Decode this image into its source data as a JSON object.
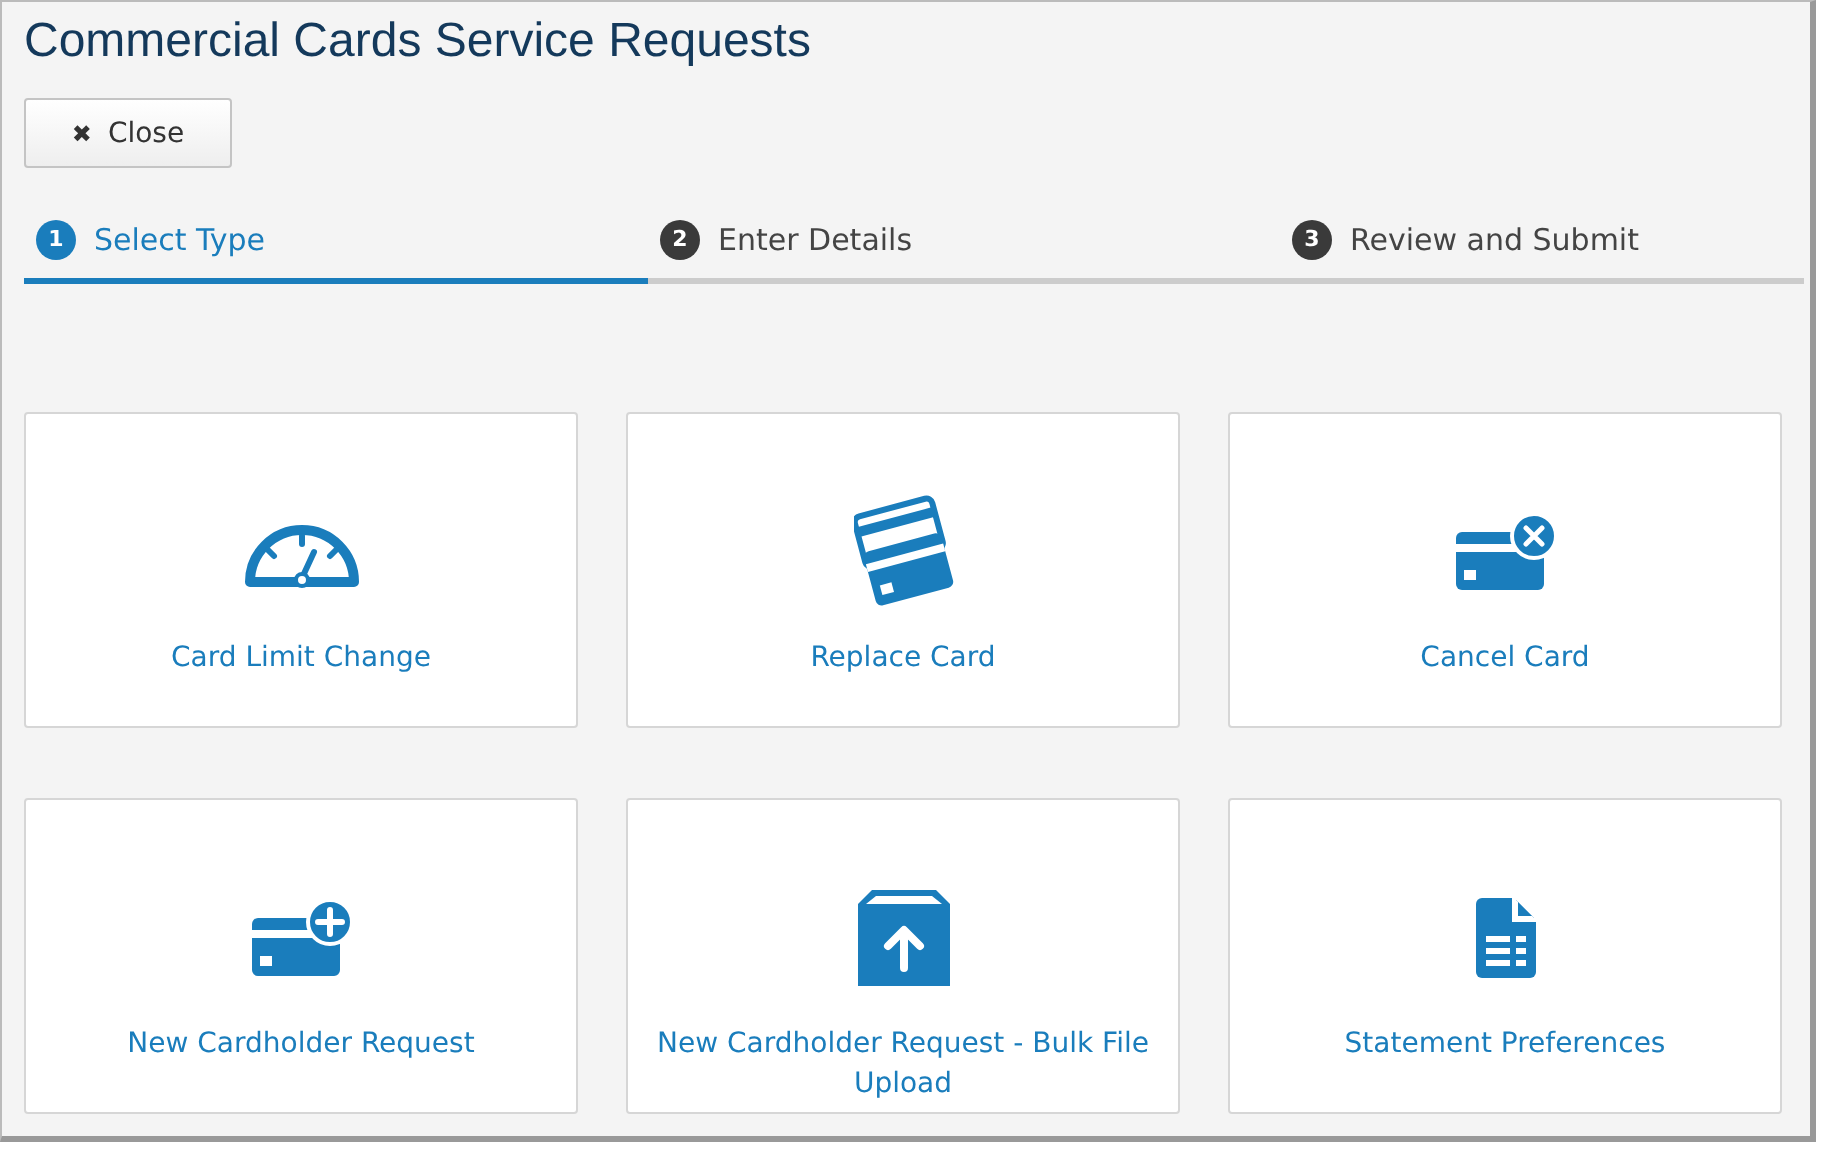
{
  "page": {
    "title": "Commercial Cards Service Requests"
  },
  "close_button": {
    "icon": "✖",
    "label": "Close"
  },
  "steps": [
    {
      "number": "1",
      "label": "Select Type",
      "selected": true
    },
    {
      "number": "2",
      "label": "Enter Details",
      "selected": false
    },
    {
      "number": "3",
      "label": "Review and Submit",
      "selected": false
    }
  ],
  "request_types": [
    {
      "label": "Card Limit Change"
    },
    {
      "label": "Replace Card"
    },
    {
      "label": "Cancel Card"
    },
    {
      "label": "New Cardholder Request"
    },
    {
      "label": "New Cardholder Request - Bulk File Upload"
    },
    {
      "label": "Statement Preferences"
    }
  ]
}
